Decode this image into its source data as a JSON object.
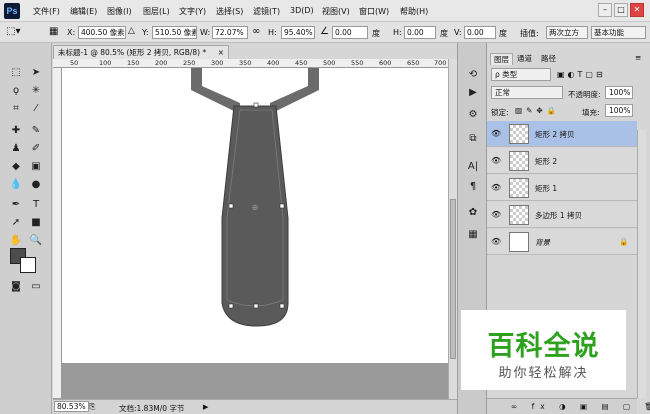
{
  "menubar": {
    "logo": "Ps",
    "items": [
      "文件(F)",
      "编辑(E)",
      "图像(I)",
      "图层(L)",
      "文字(Y)",
      "选择(S)",
      "滤镜(T)",
      "3D(D)",
      "视图(V)",
      "窗口(W)",
      "帮助(H)"
    ],
    "window_buttons": [
      "–",
      "□",
      "✕"
    ]
  },
  "options": {
    "x_label": "X:",
    "x_value": "400.50 像素",
    "y_label": "Y:",
    "y_value": "510.50 像素",
    "w_label": "W:",
    "w_value": "72.07%",
    "h_label": "H:",
    "h_value": "95.40%",
    "rot_value": "0.00",
    "deg": "度",
    "hskew_label": "H:",
    "hskew_value": "0.00",
    "vskew_label": "V:",
    "vskew_value": "0.00",
    "interp_label": "插值:",
    "interp_value": "两次立方",
    "workspace": "基本功能"
  },
  "document": {
    "tab": "未标题-1 @ 80.5% (矩形 2 拷贝, RGB/8) *",
    "close": "×",
    "ruler_labels": [
      "50",
      "100",
      "150",
      "200",
      "250",
      "300",
      "350",
      "400",
      "450",
      "500",
      "550",
      "600",
      "650",
      "700"
    ]
  },
  "status": {
    "zoom": "80.53%",
    "doc_info": "文档:1.83M/0 字节"
  },
  "panels": {
    "tabs": [
      "图层",
      "通道",
      "路径"
    ],
    "kind_filter": "ρ 类型",
    "blend_mode": "正常",
    "opacity_label": "不透明度:",
    "opacity_value": "100%",
    "lock_label": "锁定:",
    "fill_label": "填充:",
    "fill_value": "100%",
    "layers": [
      {
        "name": "矩形 2 拷贝",
        "selected": true
      },
      {
        "name": "矩形 2",
        "selected": false
      },
      {
        "name": "矩形 1",
        "selected": false
      },
      {
        "name": "多边形 1 拷贝",
        "selected": false
      },
      {
        "name": "背景",
        "selected": false
      }
    ]
  },
  "watermark": {
    "title": "百科全说",
    "subtitle": "助你轻松解决"
  }
}
